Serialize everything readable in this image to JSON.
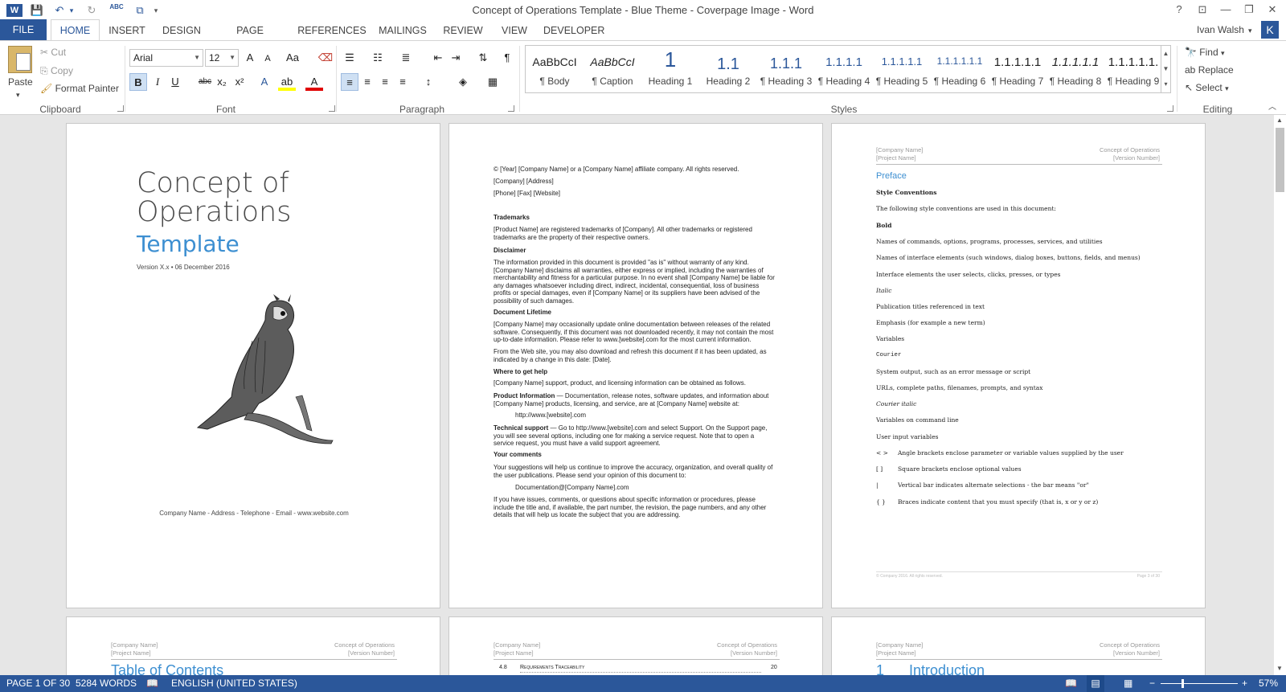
{
  "window": {
    "title": "Concept of Operations Template - Blue Theme - Coverpage Image - Word",
    "help": "?",
    "minimize": "—",
    "restore": "❐",
    "close": "✕"
  },
  "qat": {
    "undo": "↶",
    "redo": "↻",
    "spelling": "ABC",
    "more": "▾"
  },
  "tabs": [
    "FILE",
    "HOME",
    "INSERT",
    "DESIGN",
    "PAGE LAYOUT",
    "REFERENCES",
    "MAILINGS",
    "REVIEW",
    "VIEW",
    "DEVELOPER"
  ],
  "user": {
    "name": "Ivan Walsh",
    "initial": "K"
  },
  "clipboard": {
    "paste": "Paste",
    "cut": "Cut",
    "copy": "Copy",
    "format_painter": "Format Painter",
    "group": "Clipboard"
  },
  "font": {
    "name": "Arial",
    "size": "12",
    "group": "Font",
    "grow": "A",
    "shrink": "A",
    "case": "Aa",
    "bold": "B",
    "italic": "I",
    "underline": "U",
    "strike": "abc",
    "sub": "x₂",
    "sup": "x²"
  },
  "paragraph": {
    "group": "Paragraph"
  },
  "styles": {
    "group": "Styles",
    "items": [
      {
        "preview": "AaBbCcI",
        "name": "¶ Body"
      },
      {
        "preview": "AaBbCcI",
        "name": "¶ Caption"
      },
      {
        "preview": "1",
        "name": "Heading 1"
      },
      {
        "preview": "1.1",
        "name": "Heading 2"
      },
      {
        "preview": "1.1.1",
        "name": "¶ Heading 3"
      },
      {
        "preview": "1.1.1.1",
        "name": "¶ Heading 4"
      },
      {
        "preview": "1.1.1.1.1",
        "name": "¶ Heading 5"
      },
      {
        "preview": "1.1.1.1.1.1",
        "name": "¶ Heading 6"
      },
      {
        "preview": "1.1.1.1.1",
        "name": "¶ Heading 7"
      },
      {
        "preview": "1.1.1.1.1",
        "name": "¶ Heading 8"
      },
      {
        "preview": "1.1.1.1.1.",
        "name": "¶ Heading 9"
      }
    ]
  },
  "editing": {
    "find": "Find",
    "replace": "Replace",
    "select": "Select",
    "group": "Editing"
  },
  "page1": {
    "title1": "Concept of",
    "title2": "Operations",
    "subtitle": "Template",
    "version": "Version X.x • 06 December 2016",
    "footer": "Company Name - Address - Telephone - Email - www.website.com"
  },
  "page2": {
    "copyright": "© [Year] [Company Name] or a [Company Name] affiliate company. All rights reserved.",
    "company_addr": "[Company] [Address]",
    "phone": "[Phone] [Fax] [Website]",
    "trademarks_h": "Trademarks",
    "trademarks": "[Product Name] are registered trademarks of [Company]. All other trademarks or registered trademarks are the property of their respective owners.",
    "disclaimer_h": "Disclaimer",
    "disclaimer": "The information provided in this document is provided \"as is\" without warranty of any kind. [Company Name] disclaims all warranties, either express or implied, including the warranties of merchantability and fitness for a particular purpose. In no event shall [Company Name] be liable for any damages whatsoever including direct, indirect, incidental, consequential, loss of business profits or special damages, even if [Company Name] or its suppliers have been advised of the possibility of such damages.",
    "lifetime_h": "Document Lifetime",
    "lifetime1": "[Company Name] may occasionally update online documentation between releases of the related software. Consequently, if this document was not downloaded recently, it may not contain the most up-to-date information. Please refer to www.[website].com for the most current information.",
    "lifetime2": "From the Web site, you may also download and refresh this document if it has been updated, as indicated by a change in this date: [Date].",
    "help_h": "Where to get help",
    "help1": "[Company Name] support, product, and licensing information can be obtained as follows.",
    "prodinfo_b": "Product Information",
    "prodinfo": " — Documentation, release notes, software updates, and information about [Company Name] products, licensing, and service, are at [Company Name] website at:",
    "url1": "http://www.[website].com",
    "tech_b": "Technical support",
    "tech": " — Go to http://www.[website].com and select Support. On the Support page, you will see several options, including one for making a service request. Note that to open a service request, you must have a valid support agreement.",
    "comments_h": "Your comments",
    "comments1": "Your suggestions will help us continue to improve the accuracy, organization, and overall quality of the user publications. Please send your opinion of this document to:",
    "email": "Documentation@[Company Name].com",
    "comments2": "If you have issues, comments, or questions about specific information or procedures, please include the title and, if available, the part number, the revision, the page numbers, and any other details that will help us locate the subject that you are addressing."
  },
  "page3": {
    "hdr_l1": "[Company Name]",
    "hdr_l2": "[Project Name]",
    "hdr_r1": "Concept of Operations",
    "hdr_r2": "[Version Number]",
    "preface": "Preface",
    "style_conv": "Style Conventions",
    "intro": "The following style conventions are used in this document:",
    "lines": [
      {
        "t": "Bold",
        "s": "b"
      },
      {
        "t": "Names of commands, options, programs, processes, services, and utilities",
        "s": ""
      },
      {
        "t": "Names of interface elements (such windows, dialog boxes, buttons, fields, and menus)",
        "s": ""
      },
      {
        "t": "Interface elements the user selects, clicks, presses, or types",
        "s": ""
      },
      {
        "t": "Italic",
        "s": "i"
      },
      {
        "t": "Publication titles referenced in text",
        "s": ""
      },
      {
        "t": "Emphasis (for example a new term)",
        "s": ""
      },
      {
        "t": "Variables",
        "s": ""
      },
      {
        "t": "Courier",
        "s": "m"
      },
      {
        "t": "System output, such as an error message or script",
        "s": ""
      },
      {
        "t": "URLs, complete paths, filenames, prompts, and syntax",
        "s": ""
      },
      {
        "t": "Courier italic",
        "s": "i"
      },
      {
        "t": "Variables on command line",
        "s": ""
      },
      {
        "t": "User input variables",
        "s": ""
      }
    ],
    "symbols": [
      {
        "k": "< >",
        "v": "Angle brackets enclose parameter or variable values supplied by the user"
      },
      {
        "k": "[ ]",
        "v": "Square brackets enclose optional values"
      },
      {
        "k": "|",
        "v": "Vertical bar indicates alternate selections - the bar means \"or\""
      },
      {
        "k": "{ }",
        "v": "Braces indicate content that you must specify (that is, x or y or z)"
      }
    ],
    "footer_l": "© Company 2016. All rights reserved.",
    "footer_r": "Page 3 of 30"
  },
  "page4": {
    "title": "Table of Contents"
  },
  "page5": {
    "toc_num": "4.8",
    "toc_entry": "Requirements Traceability",
    "toc_page": "20"
  },
  "page6": {
    "num": "1",
    "title": "Introduction"
  },
  "status": {
    "page": "PAGE 1 OF 30",
    "words": "5284 WORDS",
    "lang": "ENGLISH (UNITED STATES)",
    "zoom": "57%"
  }
}
